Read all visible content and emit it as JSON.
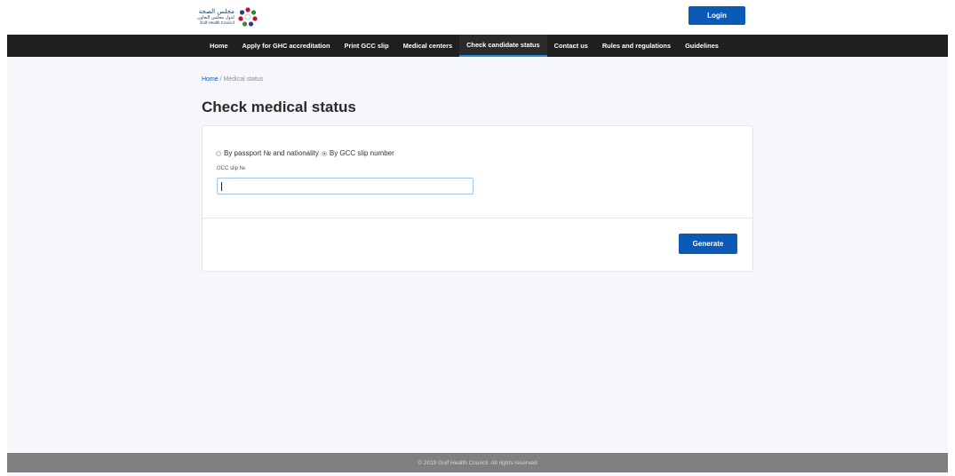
{
  "header": {
    "logo": {
      "arabic_line1": "مجلس الصحة",
      "arabic_line2": "لدول مجلس التعاون",
      "english": "Gulf Health Council"
    },
    "login_label": "Login"
  },
  "nav": {
    "items": [
      {
        "label": "Home"
      },
      {
        "label": "Apply for GHC accreditation"
      },
      {
        "label": "Print GCC slip"
      },
      {
        "label": "Medical centers"
      },
      {
        "label": "Check candidate status",
        "active": true
      },
      {
        "label": "Contact us"
      },
      {
        "label": "Rules and regulations"
      },
      {
        "label": "Guidelines"
      }
    ]
  },
  "breadcrumb": {
    "home": "Home",
    "separator": "/",
    "current": "Medical status"
  },
  "page_title": "Check medical status",
  "form": {
    "radio_options": [
      {
        "label": "By passport № and nationality",
        "checked": false
      },
      {
        "label": "By GCC slip number",
        "checked": true
      }
    ],
    "field_label": "GCC slip №",
    "slip_value": "",
    "generate_label": "Generate"
  },
  "footer": {
    "text": "© 2019 Gulf Health Council. All rights reserved"
  },
  "colors": {
    "primary": "#0b5ab8",
    "navbar": "#1f1f1f",
    "active_underline": "#2a8be6",
    "page_bg": "#f5f7fa",
    "footer": "#808080"
  }
}
